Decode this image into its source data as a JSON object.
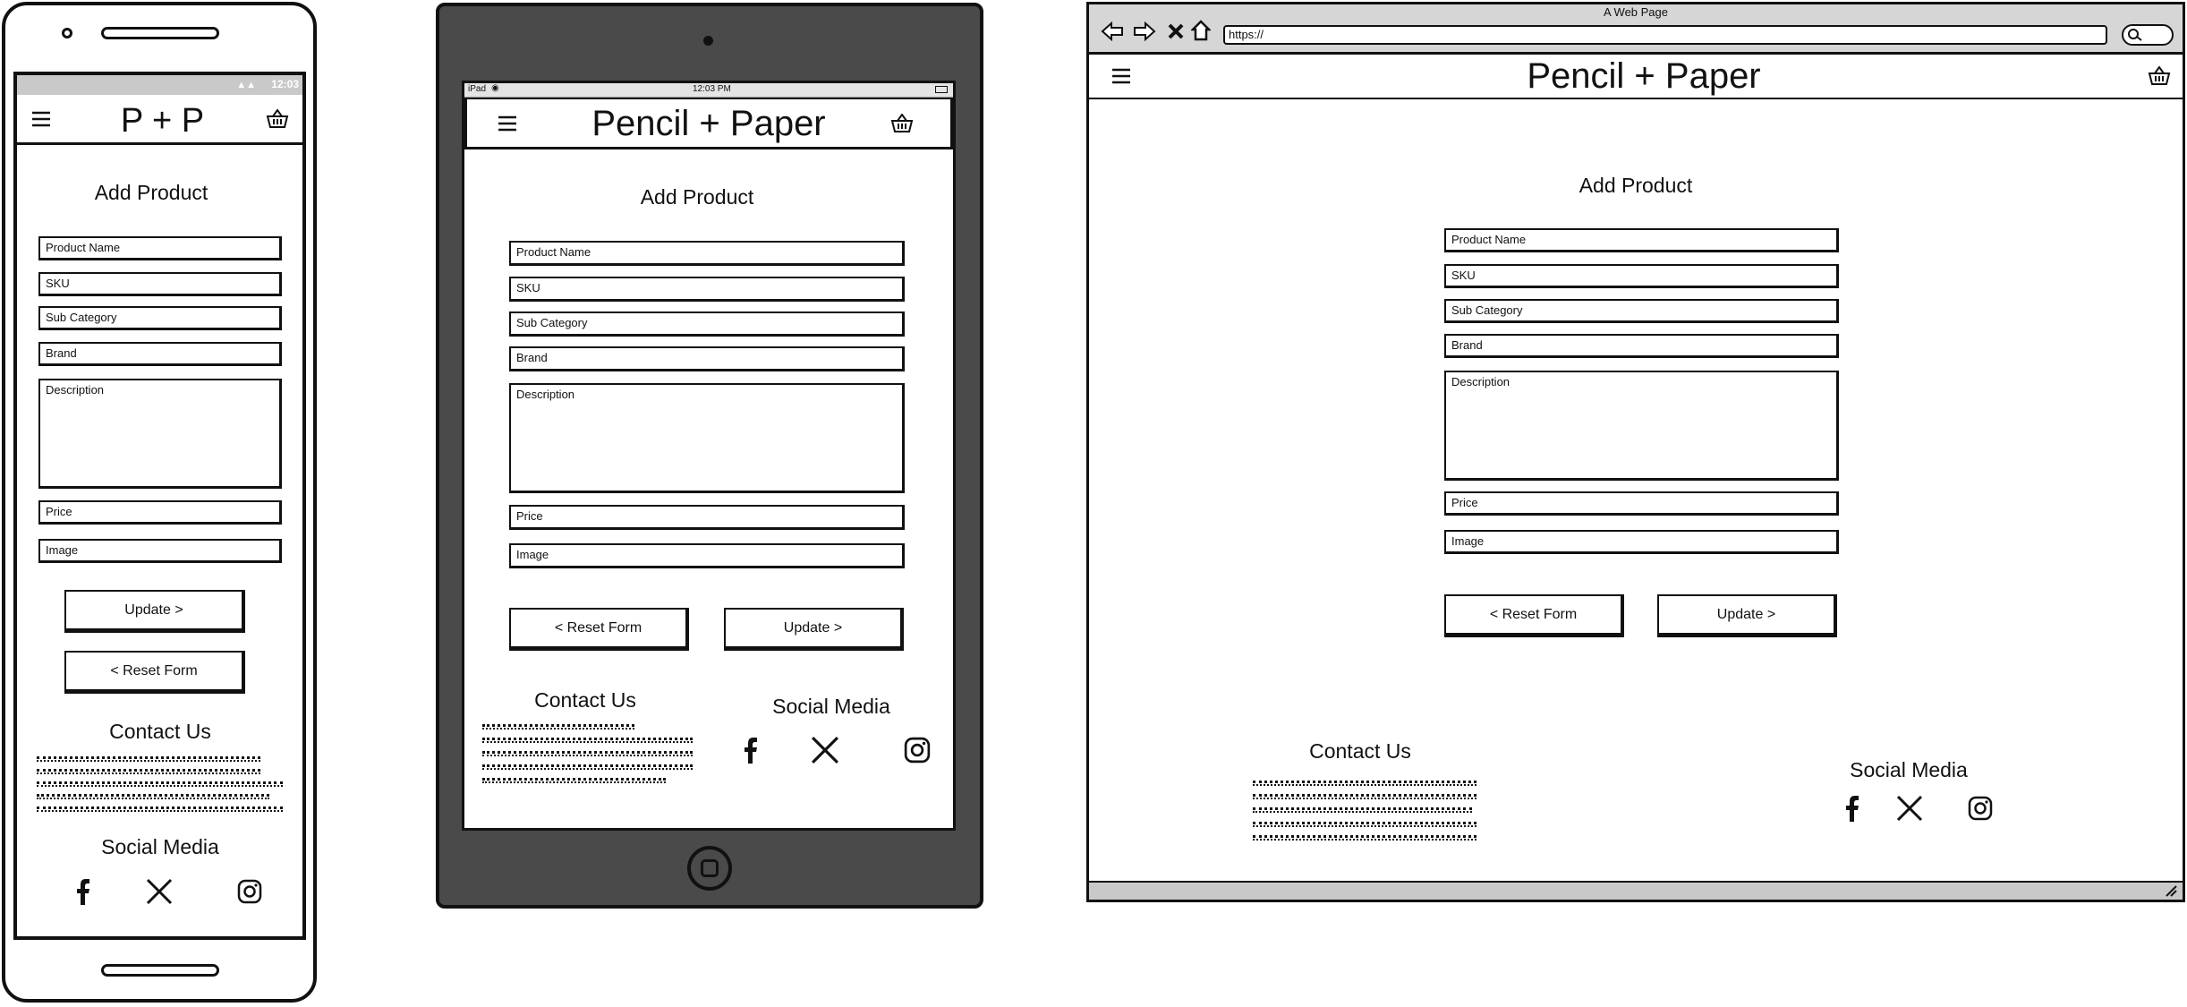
{
  "phone": {
    "status_time": "12:03",
    "brand": "P + P",
    "page_title": "Add Product",
    "fields": [
      "Product Name",
      "SKU",
      "Sub Category",
      "Brand",
      "Description",
      "Price",
      "Image"
    ],
    "update_label": "Update >",
    "reset_label": "< Reset Form",
    "contact_heading": "Contact Us",
    "social_heading": "Social Media"
  },
  "tablet": {
    "status_left": "iPad",
    "status_time": "12:03 PM",
    "brand": "Pencil + Paper",
    "page_title": "Add Product",
    "fields": [
      "Product Name",
      "SKU",
      "Sub Category",
      "Brand",
      "Description",
      "Price",
      "Image"
    ],
    "reset_label": "< Reset Form",
    "update_label": "Update >",
    "contact_heading": "Contact Us",
    "social_heading": "Social Media"
  },
  "browser": {
    "window_title": "A Web Page",
    "url": "https://",
    "brand": "Pencil + Paper",
    "page_title": "Add Product",
    "fields": [
      "Product Name",
      "SKU",
      "Sub Category",
      "Brand",
      "Description",
      "Price",
      "Image"
    ],
    "reset_label": "< Reset Form",
    "update_label": "Update >",
    "contact_heading": "Contact Us",
    "social_heading": "Social Media"
  },
  "icons": {
    "menu": "hamburger-icon",
    "cart": "basket-icon",
    "social": [
      "facebook-icon",
      "x-icon",
      "instagram-icon"
    ],
    "nav": [
      "back-arrow-icon",
      "forward-arrow-icon",
      "close-icon",
      "home-icon",
      "search-icon"
    ]
  }
}
